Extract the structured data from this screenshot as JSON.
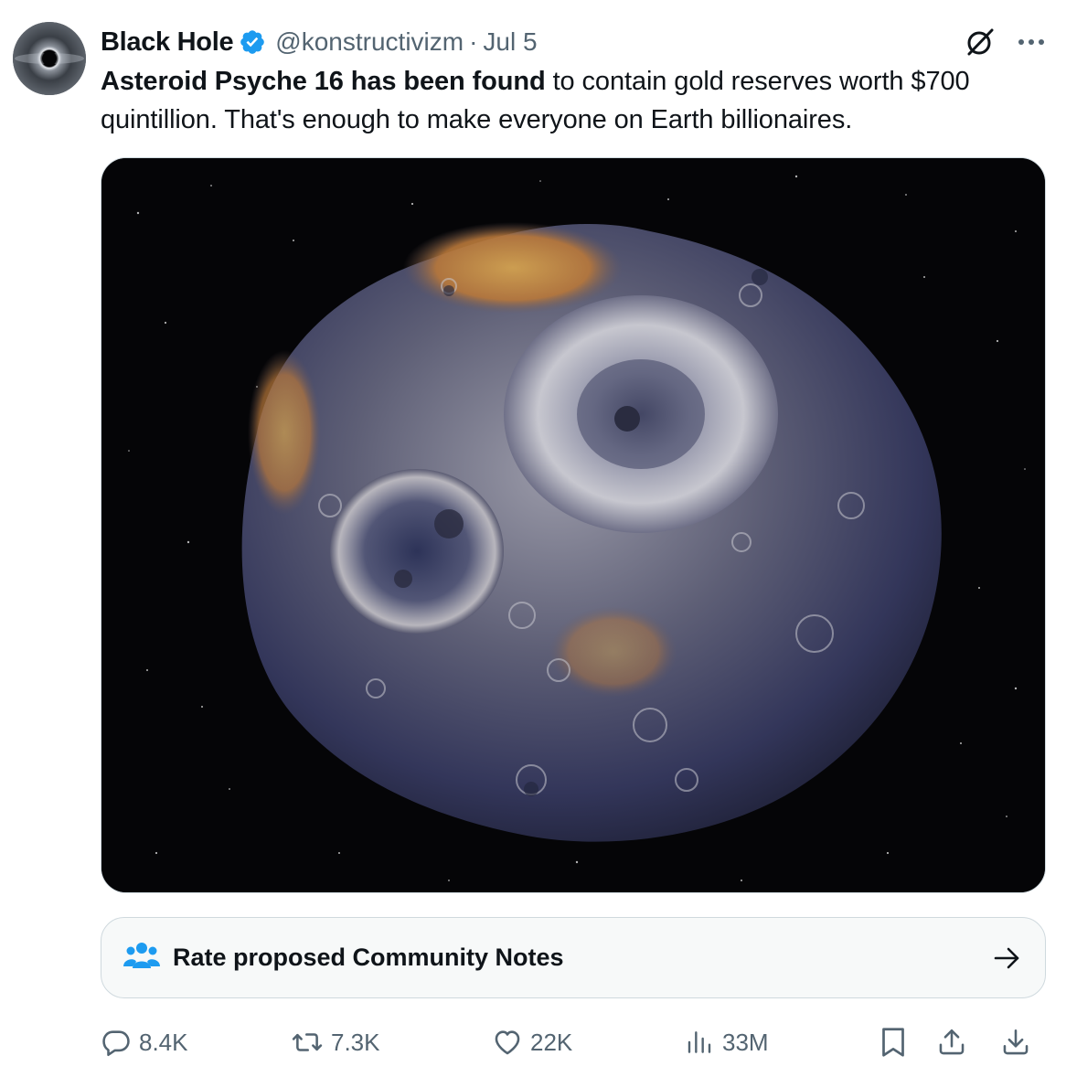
{
  "author": {
    "display_name": "Black Hole",
    "handle": "@konstructivizm",
    "separator": "·",
    "date": "Jul 5",
    "verified": true
  },
  "tweet": {
    "bold_text": "Asteroid Psyche 16 has been found",
    "rest_text": " to contain gold reserves worth $700 quintillion. That's enough to make everyone on Earth billionaires."
  },
  "community_notes": {
    "label": "Rate proposed Community Notes",
    "icon": "people-icon",
    "arrow_icon": "arrow-right-icon"
  },
  "actions": {
    "replies": "8.4K",
    "retweets": "7.3K",
    "likes": "22K",
    "views": "33M"
  },
  "colors": {
    "text_primary": "#0f1419",
    "text_secondary": "#536471",
    "verified_blue": "#1d9bf0",
    "border": "#cfd9de",
    "notes_bg": "#f7f9f9"
  }
}
